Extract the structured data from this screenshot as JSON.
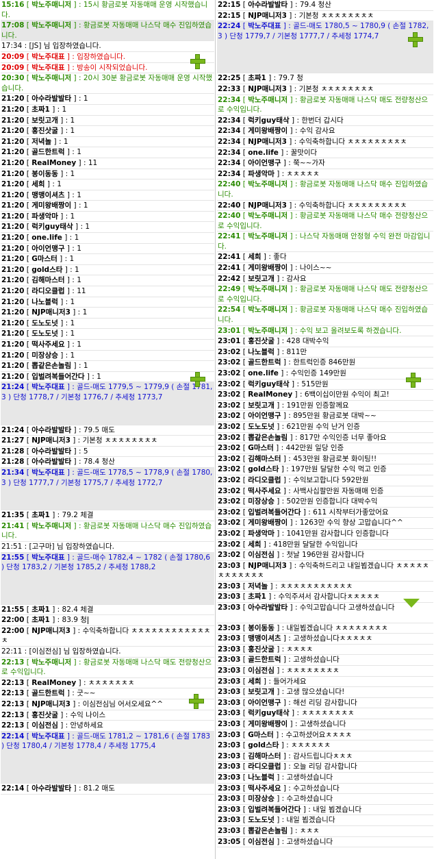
{
  "left": [
    {
      "t": "15:16",
      "n": "박노주매니저",
      "m": "15시 황금로봇 자동매매 운영 시작했습니다.",
      "c": "green",
      "hl": false
    },
    {
      "t": "17:08",
      "n": "박노주매니저",
      "m": "황금로봇 자동매매 나스닥 매수 진입하였습니다.",
      "c": "green",
      "hl": true
    },
    {
      "sys": "17:34 : [JS] 님 입장하였습니다.",
      "c": "sys",
      "hl": false
    },
    {
      "t": "20:09",
      "n": "박노주대표",
      "m": "입장하였습니다.",
      "c": "red",
      "hl": false
    },
    {
      "t": "20:09",
      "n": "박노주대표",
      "m": "방송이 시작되었습니다.",
      "c": "red",
      "hl": false
    },
    {
      "t": "20:30",
      "n": "박노주매니저",
      "m": "20시 30분 황금로봇 자동매매 운영 시작했습니다.",
      "c": "green",
      "hl": false
    },
    {
      "t": "21:20",
      "n": "아수라발발타",
      "m": "1",
      "c": "",
      "hl": false
    },
    {
      "t": "21:20",
      "n": "초짜1",
      "m": "1",
      "c": "",
      "hl": false
    },
    {
      "t": "21:20",
      "n": "보릿고개",
      "m": "1",
      "c": "",
      "hl": false
    },
    {
      "t": "21:20",
      "n": "홍진삿굴",
      "m": "1",
      "c": "",
      "hl": false
    },
    {
      "t": "21:20",
      "n": "저녁놀",
      "m": "1",
      "c": "",
      "hl": false
    },
    {
      "t": "21:20",
      "n": "골드한트럭",
      "m": "1",
      "c": "",
      "hl": false
    },
    {
      "t": "21:20",
      "n": "RealMoney",
      "m": "11",
      "c": "",
      "hl": false
    },
    {
      "t": "21:20",
      "n": "봉이동동",
      "m": "1",
      "c": "",
      "hl": false
    },
    {
      "t": "21:20",
      "n": "세희",
      "m": "1",
      "c": "",
      "hl": false
    },
    {
      "t": "21:20",
      "n": "맹맹이셔츠",
      "m": "1",
      "c": "",
      "hl": false
    },
    {
      "t": "21:20",
      "n": "게미왕배짱이",
      "m": "1",
      "c": "",
      "hl": false
    },
    {
      "t": "21:20",
      "n": "파생악마",
      "m": "1",
      "c": "",
      "hl": false
    },
    {
      "t": "21:20",
      "n": "럭키guy태삭",
      "m": "1",
      "c": "",
      "hl": false
    },
    {
      "t": "21:20",
      "n": "one.life",
      "m": "1",
      "c": "",
      "hl": false
    },
    {
      "t": "21:20",
      "n": "아이언맹구",
      "m": "1",
      "c": "",
      "hl": false
    },
    {
      "t": "21:20",
      "n": "G마스터",
      "m": "1",
      "c": "",
      "hl": false
    },
    {
      "t": "21:20",
      "n": "gold스타",
      "m": "1",
      "c": "",
      "hl": false
    },
    {
      "t": "21:20",
      "n": "김해마스터",
      "m": "1",
      "c": "",
      "hl": false
    },
    {
      "t": "21:20",
      "n": "라디오클럽",
      "m": "11",
      "c": "",
      "hl": false
    },
    {
      "t": "21:20",
      "n": "나노블럭",
      "m": "1",
      "c": "",
      "hl": false
    },
    {
      "t": "21:20",
      "n": "NJP매니저3",
      "m": "1",
      "c": "",
      "hl": false
    },
    {
      "t": "21:20",
      "n": "도노도넛",
      "m": "1",
      "c": "",
      "hl": false
    },
    {
      "t": "21:20",
      "n": "도노도넛",
      "m": "1",
      "c": "",
      "hl": false
    },
    {
      "t": "21:20",
      "n": "떡사주세요",
      "m": "1",
      "c": "",
      "hl": false
    },
    {
      "t": "21:20",
      "n": "미장상승",
      "m": "1",
      "c": "",
      "hl": false
    },
    {
      "t": "21:20",
      "n": "뽑같은손놀림",
      "m": "1",
      "c": "",
      "hl": false
    },
    {
      "t": "21:20",
      "n": "입벌려복들어간다",
      "m": "1",
      "c": "",
      "hl": false
    },
    {
      "t": "21:24",
      "n": "박노주대표",
      "m": "골드-매도 1779,5 ~ 1779,9 ( 손절 1781,3 ) 단청 1778,7 / 기본청 1776,7 / 추세청 1773,7",
      "c": "blue",
      "hl": true,
      "gap": 32
    },
    {
      "t": "21:24",
      "n": "아수라발발타",
      "m": "79.5 매도",
      "c": "",
      "hl": false
    },
    {
      "t": "21:27",
      "n": "NJP매니저3",
      "m": "기본청 ㅊㅊㅊㅊㅊㅊㅊㅊ",
      "c": "",
      "hl": false
    },
    {
      "t": "21:28",
      "n": "아수라발발타",
      "m": "5",
      "c": "",
      "hl": false
    },
    {
      "t": "21:28",
      "n": "아수라발발타",
      "m": "78.4 청산",
      "c": "",
      "hl": false
    },
    {
      "t": "21:34",
      "n": "박노주대표",
      "m": "골드-매도 1778,5 ~ 1778,9 ( 손절 1780,3 ) 단청 1777,7 / 기본청 1775,7 / 추세청 1772,7",
      "c": "blue",
      "hl": true,
      "gap": 32
    },
    {
      "t": "21:35",
      "n": "초짜1",
      "m": "79.2 체결",
      "c": "",
      "hl": false
    },
    {
      "t": "21:41",
      "n": "박노주매니저",
      "m": "황금로봇 자동매매 나스닥 매수 진입하였습니다.",
      "c": "green",
      "hl": false
    },
    {
      "sys": "21:51 : [고구마] 님 입장하였습니다.",
      "c": "sys",
      "hl": false
    },
    {
      "t": "21:55",
      "n": "박노주대표",
      "m": "골드-매수 1782,4 ~ 1782 ( 손절 1780,6 ) 단청 1783,2 / 기본청 1785,2 / 추세청 1788,2",
      "c": "blue",
      "hl": true,
      "gap": 46
    },
    {
      "t": "21:55",
      "n": "초짜1",
      "m": "82.4 체결",
      "c": "",
      "hl": false
    },
    {
      "t": "22:00",
      "n": "초짜1",
      "m": "83.9 청",
      "c": "",
      "hl": false,
      "caret": true
    },
    {
      "t": "22:00",
      "n": "NJP매니저3",
      "m": "수익축하합니다 ㅊㅊㅊㅊㅊㅊㅊㅊㅊㅊㅊㅊㅊ",
      "c": "",
      "hl": false
    },
    {
      "sys": "22:11 : [이심전심] 님 입장하였습니다.",
      "c": "sys",
      "hl": false
    },
    {
      "t": "22:13",
      "n": "박노주매니저",
      "m": "황금로봇 자동매매 나스닥 매도 전량청산으로 수익입니다.",
      "c": "green",
      "hl": false
    },
    {
      "t": "22:13",
      "n": "RealMoney",
      "m": "ㅊㅊㅊㅊㅊㅊㅊ",
      "c": "",
      "hl": false
    },
    {
      "t": "22:13",
      "n": "골드한트럭",
      "m": "굿~~",
      "c": "",
      "hl": false
    },
    {
      "t": "22:13",
      "n": "NJP매니저3",
      "m": "이심전심님 어서오세요^^",
      "c": "",
      "hl": false
    },
    {
      "t": "22:13",
      "n": "홍진삿굴",
      "m": "수익 나이스",
      "c": "",
      "hl": false
    },
    {
      "t": "22:13",
      "n": "이심전심",
      "m": "안녕하세요",
      "c": "",
      "hl": false
    },
    {
      "t": "22:14",
      "n": "박노주대표",
      "m": "골드-매도 1781,2 ~ 1781,6 ( 손절 1783 ) 단청 1780,4 / 기본청 1778,4 / 추세청 1775,4",
      "c": "blue",
      "hl": true,
      "gap": 46
    },
    {
      "t": "22:14",
      "n": "아수라발발타",
      "m": "81.2 매도",
      "c": "",
      "hl": false
    }
  ],
  "right": [
    {
      "t": "22:15",
      "n": "아수라발발타",
      "m": "79.4 청산",
      "c": "",
      "hl": false
    },
    {
      "t": "22:15",
      "n": "NJP매니저3",
      "m": "기본청 ㅊㅊㅊㅊㅊㅊㅊㅊ",
      "c": "",
      "hl": false
    },
    {
      "t": "22:24",
      "n": "박노주대표",
      "m": "골드-매도 1780,5 ~ 1780,9 ( 손절 1782,3 ) 단청 1779,7 / 기본청 1777,7 / 추세청 1774,7",
      "c": "blue",
      "hl": true,
      "gap": 46
    },
    {
      "t": "22:25",
      "n": "초짜1",
      "m": "79.7 청",
      "c": "",
      "hl": false
    },
    {
      "t": "22:33",
      "n": "NJP매니저3",
      "m": "기본청 ㅊㅊㅊㅊㅊㅊㅊㅊ",
      "c": "",
      "hl": false
    },
    {
      "t": "22:34",
      "n": "박노주매니저",
      "m": "황금로봇 자동매매 나스닥 매도 전량청산으로 수익입니다.",
      "c": "green",
      "hl": false
    },
    {
      "t": "22:34",
      "n": "럭키guy태삭",
      "m": "한번더 갑시다",
      "c": "",
      "hl": false
    },
    {
      "t": "22:34",
      "n": "게미왕배짱이",
      "m": "수익 감사요",
      "c": "",
      "hl": false
    },
    {
      "t": "22:34",
      "n": "NJP매니저3",
      "m": "수익축하합니다 ㅊㅊㅊㅊㅊㅊㅊㅊㅊ",
      "c": "",
      "hl": false
    },
    {
      "t": "22:34",
      "n": "one.life",
      "m": "꿀맛이다",
      "c": "",
      "hl": false
    },
    {
      "t": "22:34",
      "n": "아이언맹구",
      "m": "쭉~~가자",
      "c": "",
      "hl": false
    },
    {
      "t": "22:34",
      "n": "파생악마",
      "m": "ㅊㅊㅊㅊㅊ",
      "c": "",
      "hl": false
    },
    {
      "t": "22:40",
      "n": "박노주매니저",
      "m": "황금로봇 자동매매 나스닥 매수 진입하였습니다.",
      "c": "green",
      "hl": false
    },
    {
      "t": "22:40",
      "n": "NJP매니저3",
      "m": "수익축하합니다 ㅊㅊㅊㅊㅊㅊㅊㅊㅊ",
      "c": "",
      "hl": false
    },
    {
      "t": "22:40",
      "n": "박노주매니저",
      "m": "황금로봇 자동매매 나스닥 매수 전량청산으로 수익입니다.",
      "c": "green",
      "hl": false
    },
    {
      "t": "22:41",
      "n": "박노주매니저",
      "m": "나스닥 자동매매 안정형 수익 완전 마감입니다.",
      "c": "green",
      "hl": false
    },
    {
      "t": "22:41",
      "n": "세희",
      "m": "좋다",
      "c": "",
      "hl": false
    },
    {
      "t": "22:41",
      "n": "게미왕배짱이",
      "m": "나이스~~",
      "c": "",
      "hl": false
    },
    {
      "t": "22:42",
      "n": "보릿고개",
      "m": "감사요",
      "c": "",
      "hl": false
    },
    {
      "t": "22:49",
      "n": "박노주매니저",
      "m": "황금로봇 자동매매 나스닥 매도 전량청산으로 수익입니다.",
      "c": "green",
      "hl": false
    },
    {
      "t": "22:54",
      "n": "박노주매니저",
      "m": "황금로봇 자동매매 나스닥 매수 진입하였습니다.",
      "c": "green",
      "hl": false
    },
    {
      "t": "23:01",
      "n": "박노주매니저",
      "m": "수익 보고 올려보도록 하겠습니다.",
      "c": "green",
      "hl": false
    },
    {
      "t": "23:01",
      "n": "홍진삿굴",
      "m": "428  대박수익",
      "c": "",
      "hl": false
    },
    {
      "t": "23:02",
      "n": "나노블럭",
      "m": "811만",
      "c": "",
      "hl": false
    },
    {
      "t": "23:02",
      "n": "골드한트럭",
      "m": "한트럭인증 846만원",
      "c": "",
      "hl": false
    },
    {
      "t": "23:02",
      "n": "one.life",
      "m": "수익인증 149만원",
      "c": "",
      "hl": false
    },
    {
      "t": "23:02",
      "n": "럭키guy태삭",
      "m": "515만원",
      "c": "",
      "hl": false
    },
    {
      "t": "23:02",
      "n": "RealMoney",
      "m": "6백이십이만원 수익이 최고!",
      "c": "",
      "hl": false
    },
    {
      "t": "23:02",
      "n": "보릿고개",
      "m": "191만원 인증할께요",
      "c": "",
      "hl": false
    },
    {
      "t": "23:02",
      "n": "아이언맹구",
      "m": "895만원 황금로봇 대박~~",
      "c": "",
      "hl": false
    },
    {
      "t": "23:02",
      "n": "도노도넛",
      "m": "621만원 수익 난거 인증",
      "c": "",
      "hl": false
    },
    {
      "t": "23:02",
      "n": "뽑같은손놀림",
      "m": "817만 수익인증 너무 좋아요",
      "c": "",
      "hl": false
    },
    {
      "t": "23:02",
      "n": "G마스터",
      "m": "442만원 일당 인증",
      "c": "",
      "hl": false
    },
    {
      "t": "23:02",
      "n": "김해마스터",
      "m": "453만원  황금로봇 화이팅!!",
      "c": "",
      "hl": false
    },
    {
      "t": "23:02",
      "n": "gold스타",
      "m": "197만원 달달한 수익 먹고 인증",
      "c": "",
      "hl": false
    },
    {
      "t": "23:02",
      "n": "라디오클럽",
      "m": "수익보고합니다 592만원",
      "c": "",
      "hl": false
    },
    {
      "t": "23:02",
      "n": "떡사주세요",
      "m": "사백사십팔만원 자동매매 인증",
      "c": "",
      "hl": false
    },
    {
      "t": "23:02",
      "n": "미장상승",
      "m": "502만원 인증합니다 대박수익",
      "c": "",
      "hl": false
    },
    {
      "t": "23:02",
      "n": "입벌려복들어간다",
      "m": "611 시작부터가좋았어요",
      "c": "",
      "hl": false
    },
    {
      "t": "23:02",
      "n": "게미왕배짱이",
      "m": "1263만 수익 향상 고맙습니다^^",
      "c": "",
      "hl": false
    },
    {
      "t": "23:02",
      "n": "파생악마",
      "m": "1041만원 감사합니다 인증합니다",
      "c": "",
      "hl": false
    },
    {
      "t": "23:02",
      "n": "세희",
      "m": "418만원 달달한 수익입니다",
      "c": "",
      "hl": false
    },
    {
      "t": "23:02",
      "n": "이심전심",
      "m": "첫날 196만원 감사합니다",
      "c": "",
      "hl": false
    },
    {
      "t": "23:03",
      "n": "NJP매니저3",
      "m": "수익축하드리고 내일뵙겠습니다 ㅊㅊㅊㅊㅊㅊㅊㅊㅊㅊㅊㅊ",
      "c": "",
      "hl": false
    },
    {
      "t": "23:03",
      "n": "저녁놀",
      "m": "ㅊㅊㅊㅊㅊㅊㅊㅊㅊㅊㅊ",
      "c": "",
      "hl": false
    },
    {
      "t": "23:03",
      "n": "초짜1",
      "m": "수익주셔서 감사합니다ㅊㅊㅊㅊㅊ",
      "c": "",
      "hl": false
    },
    {
      "t": "23:03",
      "n": "아수라발발타",
      "m": "수익고맙습니다 고생하셨습니다",
      "c": "",
      "hl": false,
      "gap": 14
    },
    {
      "t": "23:03",
      "n": "봉이동동",
      "m": "내일뵙겠습니다 ㅊㅊㅊㅊㅊㅊㅊㅊ",
      "c": "",
      "hl": false
    },
    {
      "t": "23:03",
      "n": "맹맹이셔츠",
      "m": "고생하셨습니다ㅊㅊㅊㅊㅊ",
      "c": "",
      "hl": false
    },
    {
      "t": "23:03",
      "n": "홍진삿굴",
      "m": "ㅊㅊㅊㅊ",
      "c": "",
      "hl": false
    },
    {
      "t": "23:03",
      "n": "골드한트럭",
      "m": "고생하셨습니다",
      "c": "",
      "hl": false
    },
    {
      "t": "23:03",
      "n": "이심전심",
      "m": "ㅊㅊㅊㅊㅊㅊㅊㅊ",
      "c": "",
      "hl": false
    },
    {
      "t": "23:03",
      "n": "세희",
      "m": "들어가세요",
      "c": "",
      "hl": false
    },
    {
      "t": "23:03",
      "n": "보릿고개",
      "m": "고생 많으셨습니다!",
      "c": "",
      "hl": false
    },
    {
      "t": "23:03",
      "n": "아이언맹구",
      "m": "해선 리딩 감사합니다",
      "c": "",
      "hl": false
    },
    {
      "t": "23:03",
      "n": "럭키guy태삭",
      "m": "ㅊㅊㅊㅊㅊㅊㅊㅊ",
      "c": "",
      "hl": false
    },
    {
      "t": "23:03",
      "n": "게미왕배짱이",
      "m": "고생하셨습니다",
      "c": "",
      "hl": false
    },
    {
      "t": "23:03",
      "n": "G마스터",
      "m": "수고하셨어요ㅊㅊㅊㅊ",
      "c": "",
      "hl": false
    },
    {
      "t": "23:03",
      "n": "gold스타",
      "m": "ㅊㅊㅊㅊㅊㅊ",
      "c": "",
      "hl": false
    },
    {
      "t": "23:03",
      "n": "김해마스터",
      "m": "감사드립니다ㅊㅊㅊ",
      "c": "",
      "hl": false
    },
    {
      "t": "23:03",
      "n": "라디오클럽",
      "m": "오늘 리딩 감사합니다",
      "c": "",
      "hl": false
    },
    {
      "t": "23:03",
      "n": "나노블럭",
      "m": "고생하셨습니다",
      "c": "",
      "hl": false
    },
    {
      "t": "23:03",
      "n": "떡사주세요",
      "m": "수고하셨습니다",
      "c": "",
      "hl": false
    },
    {
      "t": "23:03",
      "n": "미장상승",
      "m": "수고하셨습니다",
      "c": "",
      "hl": false
    },
    {
      "t": "23:03",
      "n": "입벌려복들어간다",
      "m": "내일 뵙겠습니다",
      "c": "",
      "hl": false
    },
    {
      "t": "23:03",
      "n": "도노도넛",
      "m": "내일 뵙겠습니다",
      "c": "",
      "hl": false
    },
    {
      "t": "23:03",
      "n": "뽑같은손놀림",
      "m": "ㅊㅊㅊ",
      "c": "",
      "hl": false
    },
    {
      "t": "23:05",
      "n": "이심전심",
      "m": "고생하셨습니다",
      "c": "",
      "hl": false
    }
  ]
}
